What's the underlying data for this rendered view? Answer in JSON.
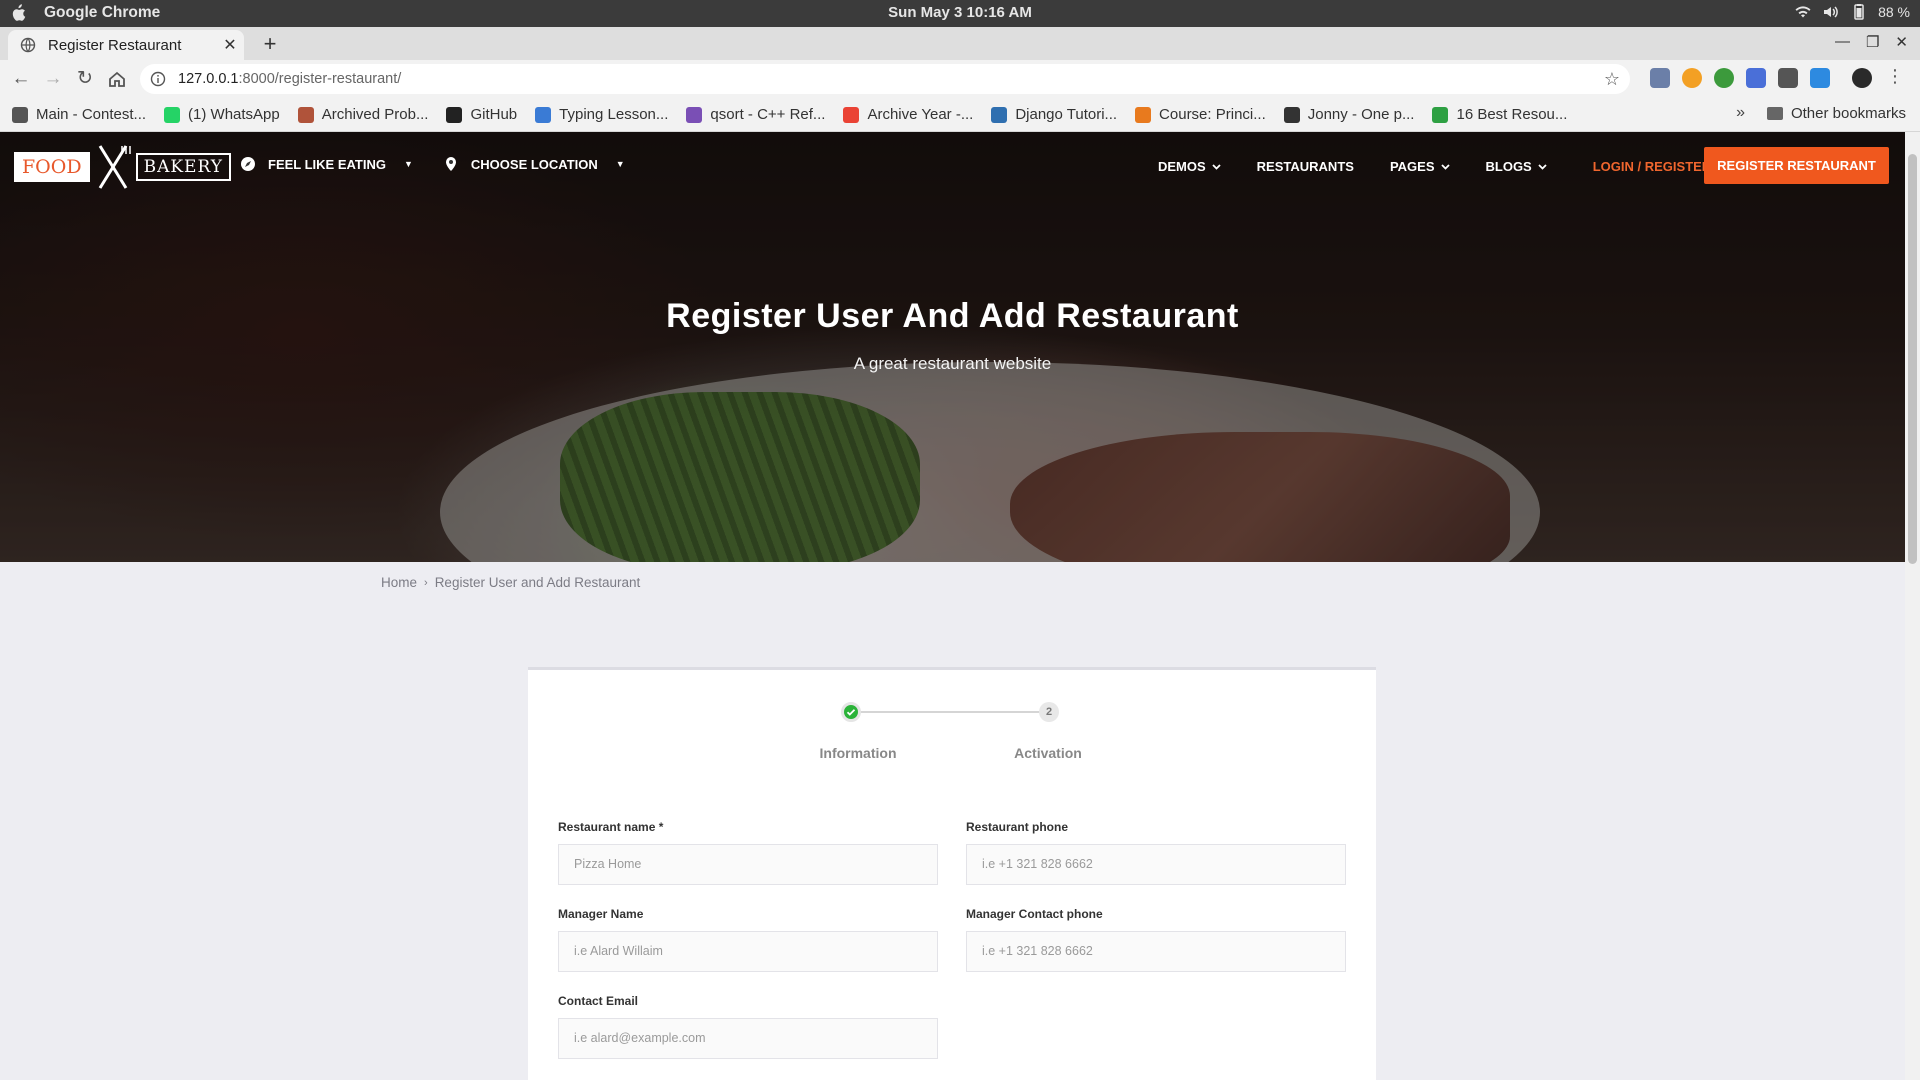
{
  "os": {
    "app_name": "Google Chrome",
    "clock": "Sun May 3  10:16 AM",
    "battery": "88 %"
  },
  "browser": {
    "tab_title": "Register Restaurant",
    "url_host": "127.0.0.1",
    "url_path": ":8000/register-restaurant/",
    "bookmarks": [
      {
        "label": "Main - Contest...",
        "color": "#555555"
      },
      {
        "label": "(1) WhatsApp",
        "color": "#25d366"
      },
      {
        "label": "Archived Prob...",
        "color": "#b0533a"
      },
      {
        "label": "GitHub",
        "color": "#222222"
      },
      {
        "label": "Typing Lesson...",
        "color": "#3a7bd5"
      },
      {
        "label": "qsort - C++ Ref...",
        "color": "#7a4fb5"
      },
      {
        "label": "Archive Year -...",
        "color": "#ea4335"
      },
      {
        "label": "Django Tutori...",
        "color": "#2f6fb0"
      },
      {
        "label": "Course: Princi...",
        "color": "#e87a1e"
      },
      {
        "label": "Jonny - One p...",
        "color": "#333333"
      },
      {
        "label": "16 Best Resou...",
        "color": "#2ea043"
      }
    ],
    "other_bookmarks": "Other bookmarks"
  },
  "site": {
    "logo_left": "FOOD",
    "logo_right": "BAKERY",
    "nav_left": [
      "FEEL LIKE EATING",
      "CHOOSE LOCATION"
    ],
    "nav_right": [
      "DEMOS",
      "RESTAURANTS",
      "PAGES",
      "BLOGS"
    ],
    "login": "LOGIN / REGISTER",
    "register_button": "REGISTER RESTAURANT",
    "accent": "#f0581e",
    "hero_title": "Register User And Add Restaurant",
    "hero_subtitle": "A great restaurant website"
  },
  "breadcrumb": {
    "home": "Home",
    "current": "Register User and Add Restaurant"
  },
  "form": {
    "steps": [
      {
        "label": "Information",
        "status": "done"
      },
      {
        "label": "Activation",
        "number": "2"
      }
    ],
    "fields": {
      "restaurant_name": {
        "label": "Restaurant name *",
        "placeholder": "Pizza Home"
      },
      "restaurant_phone": {
        "label": "Restaurant phone",
        "placeholder": "i.e +1 321 828 6662"
      },
      "manager_name": {
        "label": "Manager Name",
        "placeholder": "i.e Alard Willaim"
      },
      "manager_phone": {
        "label": "Manager Contact phone",
        "placeholder": "i.e +1 321 828 6662"
      },
      "contact_email": {
        "label": "Contact Email",
        "placeholder": "i.e alard@example.com"
      }
    }
  }
}
